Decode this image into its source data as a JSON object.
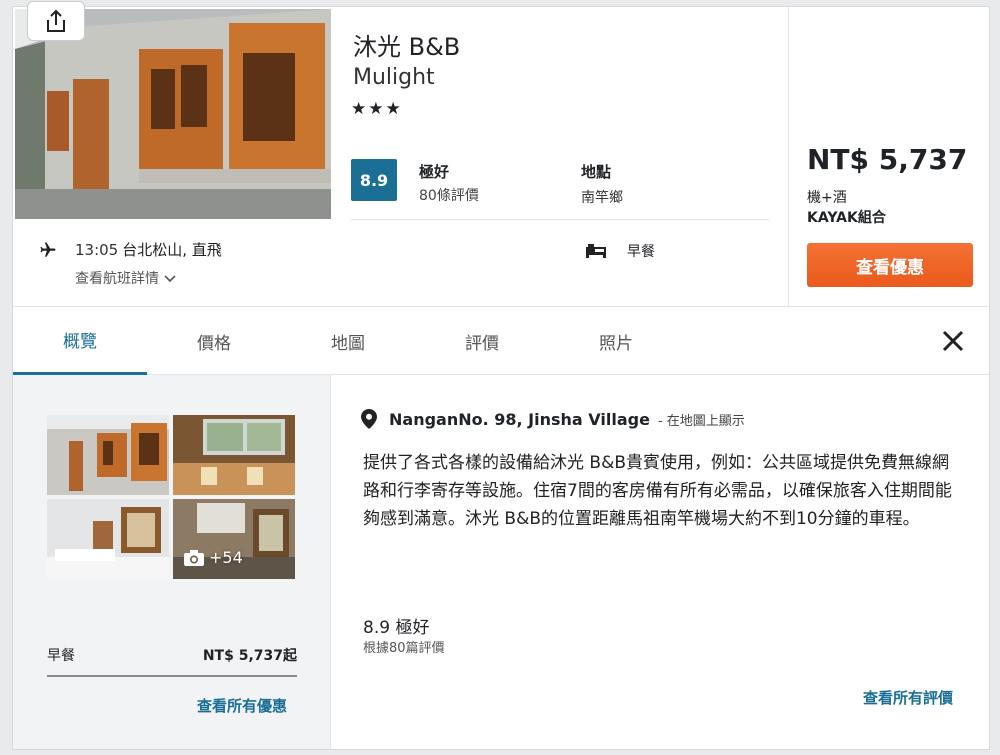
{
  "header": {
    "title": "沐光 B&B",
    "subtitle": "Mulight",
    "stars": "★★★"
  },
  "flight": {
    "time": "13:05",
    "route": "台北松山, 直飛",
    "details_link": "查看航班詳情"
  },
  "rating": {
    "score": "8.9",
    "label": "極好",
    "reviews": "80條評價"
  },
  "location": {
    "label": "地點",
    "value": "南竿鄉"
  },
  "amenity": {
    "label": "早餐"
  },
  "pricing": {
    "price": "NT$ 5,737",
    "package_line1": "機+酒",
    "package_line2": "KAYAK組合",
    "cta": "查看優惠"
  },
  "tabs": [
    {
      "label": "概覽"
    },
    {
      "label": "價格"
    },
    {
      "label": "地圖"
    },
    {
      "label": "評價"
    },
    {
      "label": "照片"
    }
  ],
  "gallery": {
    "more_count": "+54"
  },
  "rate_row": {
    "label": "早餐",
    "price": "NT$ 5,737起"
  },
  "links": {
    "all_deals": "查看所有優惠",
    "all_reviews": "查看所有評價"
  },
  "overview": {
    "address": "NanganNo. 98, Jinsha Village",
    "map_link": "- 在地圖上顯示",
    "description": "提供了各式各樣的設備給沐光 B&B貴賓使用，例如：公共區域提供免費無線網路和行李寄存等設施。住宿7間的客房備有所有必需品，以確保旅客入住期間能夠感到滿意。沐光 B&B的位置距離馬祖南竿機場大約不到10分鐘的車程。",
    "review_score": "8.9 極好",
    "review_count": "根據80篇評價"
  },
  "colors": {
    "accent": "#1b6f94",
    "cta": "#f06a2c"
  }
}
